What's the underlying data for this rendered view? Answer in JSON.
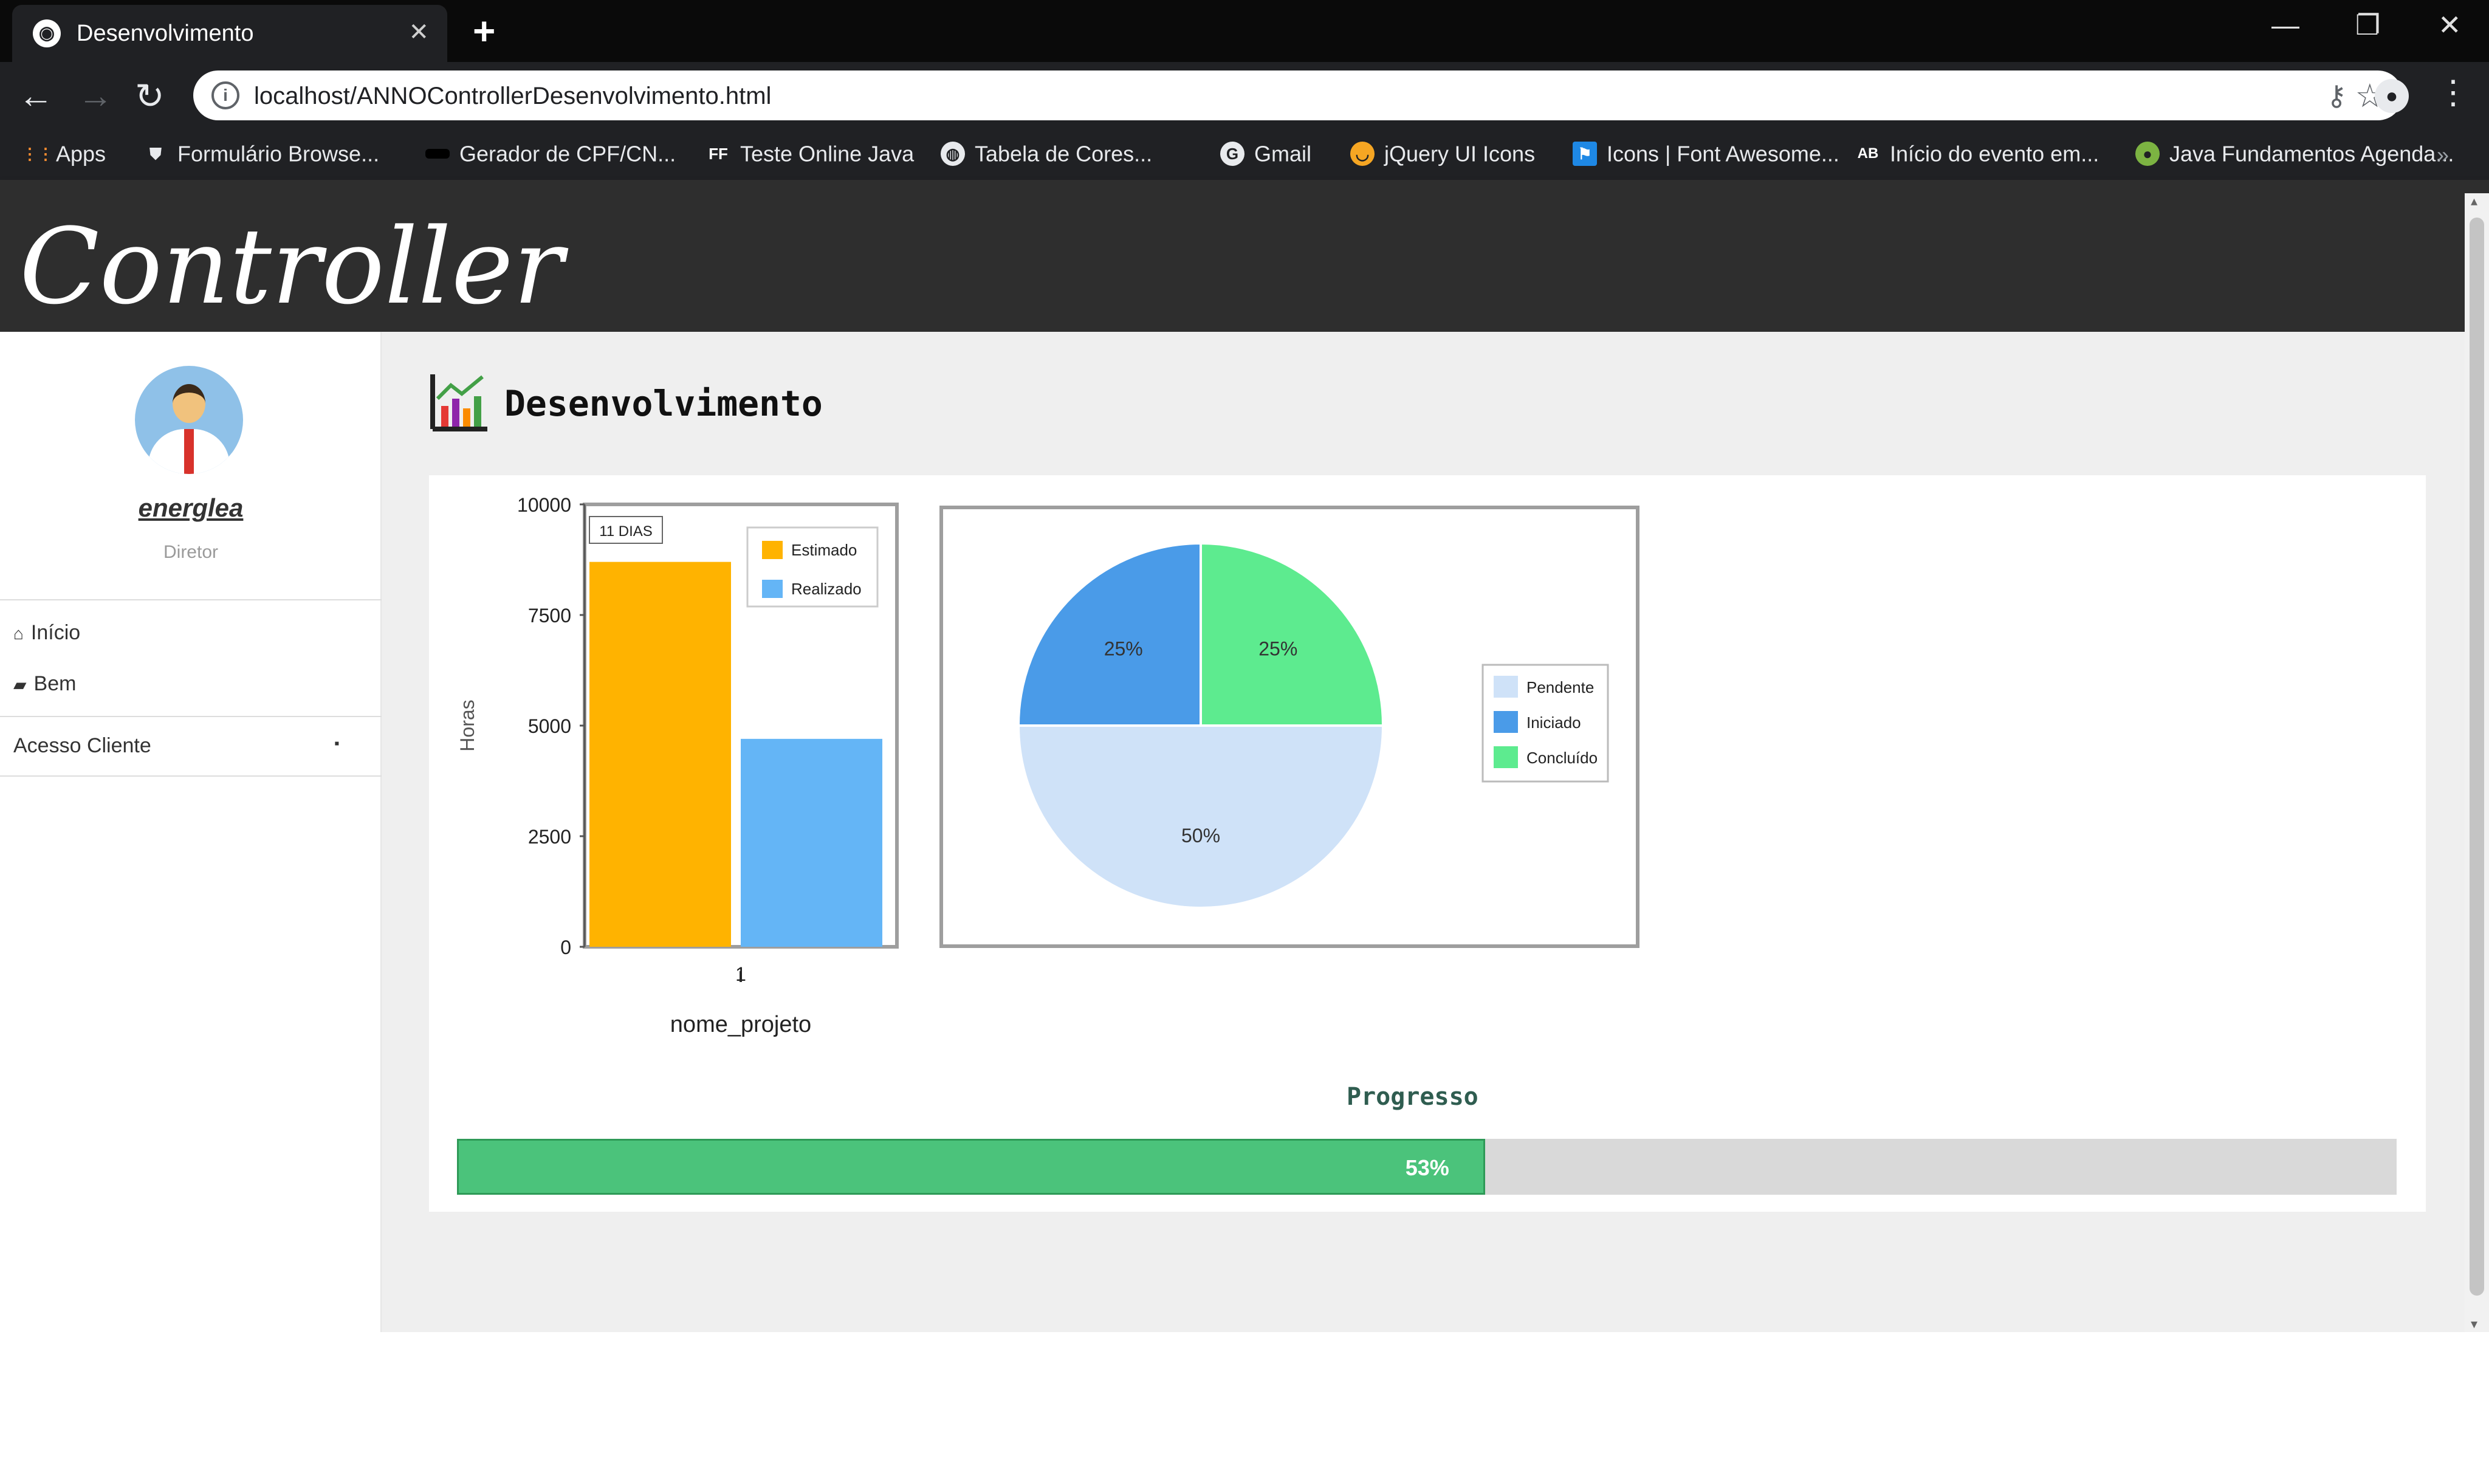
{
  "browser": {
    "tab": {
      "title": "Desenvolvimento"
    },
    "url": "localhost/ANNOControllerDesenvolvimento.html",
    "bookmarks": [
      {
        "label": "Apps",
        "icon": "apps-grid-icon"
      },
      {
        "label": "Formulário Browse...",
        "icon": "shield-icon"
      },
      {
        "label": "Gerador de CPF/CN...",
        "icon": "bookmark-dot-icon"
      },
      {
        "label": "Teste Online Java",
        "icon": "ff-icon"
      },
      {
        "label": "Tabela de Cores...",
        "icon": "globe-icon"
      },
      {
        "label": "Gmail",
        "icon": "google-icon"
      },
      {
        "label": "jQuery UI Icons",
        "icon": "jquery-icon"
      },
      {
        "label": "Icons | Font Awesome...",
        "icon": "flag-icon"
      },
      {
        "label": "Início do evento em...",
        "icon": "ab-icon"
      },
      {
        "label": "Java Fundamentos Agenda...",
        "icon": "green-circle-icon"
      }
    ]
  },
  "header": {
    "brand": "Controller"
  },
  "sidebar": {
    "user_name": "energlea",
    "user_role": "Diretor",
    "items": [
      {
        "label": "Início",
        "icon": "home-icon"
      },
      {
        "label": "Bem",
        "icon": "card-icon"
      }
    ],
    "dropdown": {
      "label": "Acesso Cliente"
    }
  },
  "main": {
    "title": "Desenvolvimento",
    "progress": {
      "title": "Progresso",
      "value": 53,
      "label": "53%"
    }
  },
  "colors": {
    "bar_orange": "#FFB300",
    "bar_blue": "#64B5F6",
    "pie_light": "#CFE2F8",
    "pie_blue": "#4A9BE8",
    "pie_green": "#5DEB8F",
    "progress_green": "#4BC37B"
  },
  "chart_data": [
    {
      "type": "bar",
      "title": "",
      "xlabel": "nome_projeto",
      "ylabel": "Horas",
      "categories": [
        "1"
      ],
      "series": [
        {
          "name": "Estimado",
          "values": [
            8700
          ]
        },
        {
          "name": "Realizado",
          "values": [
            4700
          ]
        }
      ],
      "ylim": [
        0,
        10000
      ],
      "yticks": [
        0,
        2500,
        5000,
        7500,
        10000
      ],
      "ytick_labels": [
        "0",
        "2500",
        "5000",
        "7500",
        "10000"
      ],
      "legend": "top-right",
      "annotation": "11 DIAS"
    },
    {
      "type": "pie",
      "title": "",
      "slices": [
        {
          "name": "Pendente",
          "value": 50,
          "label": "50%"
        },
        {
          "name": "Iniciado",
          "value": 25,
          "label": "25%"
        },
        {
          "name": "Concluído",
          "value": 25,
          "label": "25%"
        }
      ],
      "legend": "right"
    }
  ]
}
